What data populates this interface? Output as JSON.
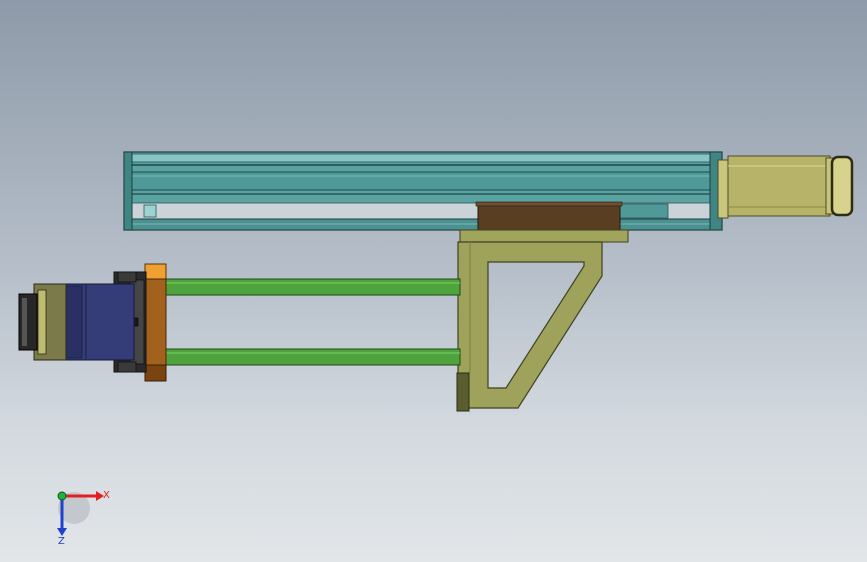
{
  "triad": {
    "x_label": "X",
    "z_label": "Z",
    "x_color": "#e02020",
    "y_color": "#20b040",
    "z_color": "#2040d0"
  },
  "colors": {
    "rail": "#4f9a99",
    "rail_light": "#73b8b6",
    "rail_dark": "#2e6f6e",
    "motor_housing": "#b8b56a",
    "carriage": "#5a3e22",
    "bracket": "#9ea25a",
    "bracket_dark": "#5a5e2e",
    "rods": "#4fa33d",
    "flange": "#a0601c",
    "flange_light": "#f0a030",
    "motor": "#353d78",
    "motor_back": "#7a7a4a",
    "black_parts": "#2a2a2a"
  }
}
